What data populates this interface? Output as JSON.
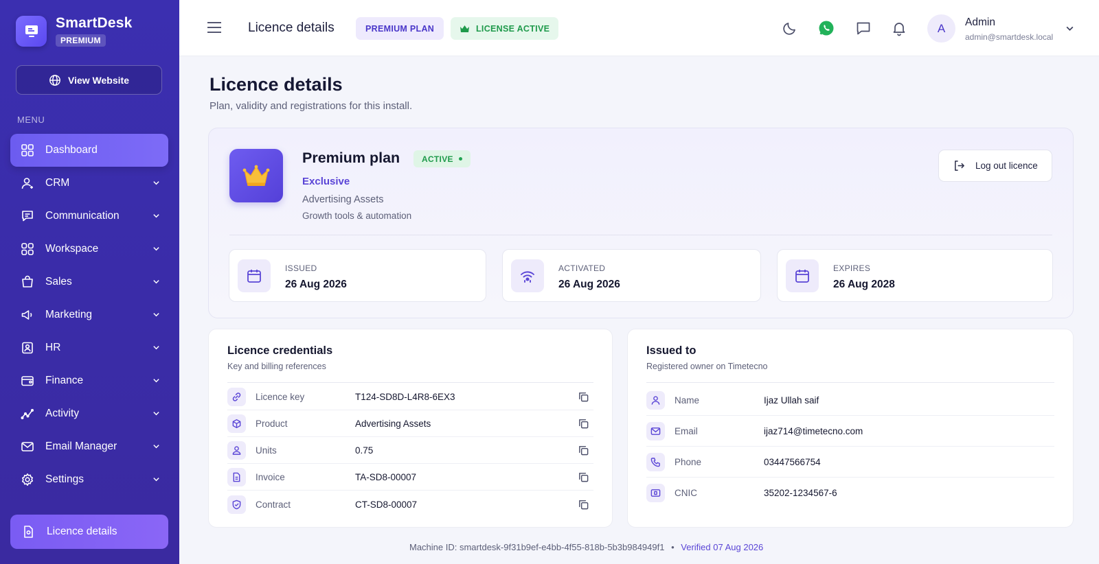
{
  "brand": {
    "name": "SmartDesk",
    "badge": "PREMIUM"
  },
  "sidebar": {
    "view_website": "View Website",
    "menu_label": "MENU",
    "items": [
      {
        "label": "Dashboard",
        "icon": "grid-icon"
      },
      {
        "label": "CRM",
        "icon": "user-icon"
      },
      {
        "label": "Communication",
        "icon": "chat-icon"
      },
      {
        "label": "Workspace",
        "icon": "apps-icon"
      },
      {
        "label": "Sales",
        "icon": "bag-icon"
      },
      {
        "label": "Marketing",
        "icon": "megaphone-icon"
      },
      {
        "label": "HR",
        "icon": "badge-icon"
      },
      {
        "label": "Finance",
        "icon": "wallet-icon"
      },
      {
        "label": "Activity",
        "icon": "trend-icon"
      },
      {
        "label": "Email Manager",
        "icon": "mail-icon"
      },
      {
        "label": "Settings",
        "icon": "gear-icon"
      }
    ],
    "bottom_item": "Licence details"
  },
  "header": {
    "title": "Licence details",
    "plan_pill": "PREMIUM PLAN",
    "license_pill": "LICENSE ACTIVE",
    "user": {
      "initial": "A",
      "name": "Admin",
      "email": "admin@smartdesk.local"
    }
  },
  "page": {
    "title": "Licence details",
    "subtitle": "Plan, validity and registrations for this install."
  },
  "plan": {
    "name": "Premium plan",
    "status": "ACTIVE",
    "tier": "Exclusive",
    "product": "Advertising Assets",
    "description": "Growth tools & automation",
    "logout_label": "Log out licence",
    "dates": [
      {
        "label": "ISSUED",
        "value": "26 Aug 2026"
      },
      {
        "label": "ACTIVATED",
        "value": "26 Aug 2026"
      },
      {
        "label": "EXPIRES",
        "value": "26 Aug 2028"
      }
    ]
  },
  "credentials": {
    "title": "Licence credentials",
    "subtitle": "Key and billing references",
    "rows": [
      {
        "label": "Licence key",
        "value": "T124-SD8D-L4R8-6EX3"
      },
      {
        "label": "Product",
        "value": "Advertising Assets"
      },
      {
        "label": "Units",
        "value": "0.75"
      },
      {
        "label": "Invoice",
        "value": "TA-SD8-00007"
      },
      {
        "label": "Contract",
        "value": "CT-SD8-00007"
      }
    ]
  },
  "issued_to": {
    "title": "Issued to",
    "subtitle": "Registered owner on Timetecno",
    "rows": [
      {
        "label": "Name",
        "value": "Ijaz Ullah saif"
      },
      {
        "label": "Email",
        "value": "ijaz714@timetecno.com"
      },
      {
        "label": "Phone",
        "value": "03447566754"
      },
      {
        "label": "CNIC",
        "value": "35202-1234567-6"
      }
    ]
  },
  "footer": {
    "machine": "Machine ID: smartdesk-9f31b9ef-e4bb-4f55-818b-5b3b984949f1",
    "separator": "•",
    "verified": "Verified 07 Aug 2026"
  },
  "colors": {
    "sidebar": "#3a2cab",
    "accent": "#5a45d6",
    "success": "#1f9a4b"
  }
}
